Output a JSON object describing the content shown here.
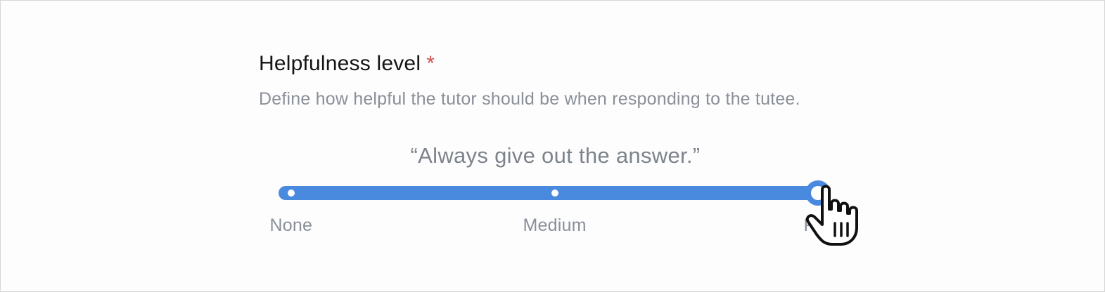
{
  "field": {
    "label": "Helpfulness level",
    "required_mark": "*",
    "description": "Define how helpful the tutor should be when responding to the tutee."
  },
  "slider": {
    "current_quote": "“Always give out the answer.”",
    "value_fraction": 1.0,
    "stops": [
      {
        "label": "None",
        "fraction": 0.0
      },
      {
        "label": "Medium",
        "fraction": 0.5
      },
      {
        "label": "Full",
        "fraction": 1.0
      }
    ]
  },
  "colors": {
    "accent": "#4a8ade",
    "required": "#d9534f",
    "muted_text": "#8a8f98"
  },
  "icons": {
    "cursor": "pointer-hand-icon"
  }
}
